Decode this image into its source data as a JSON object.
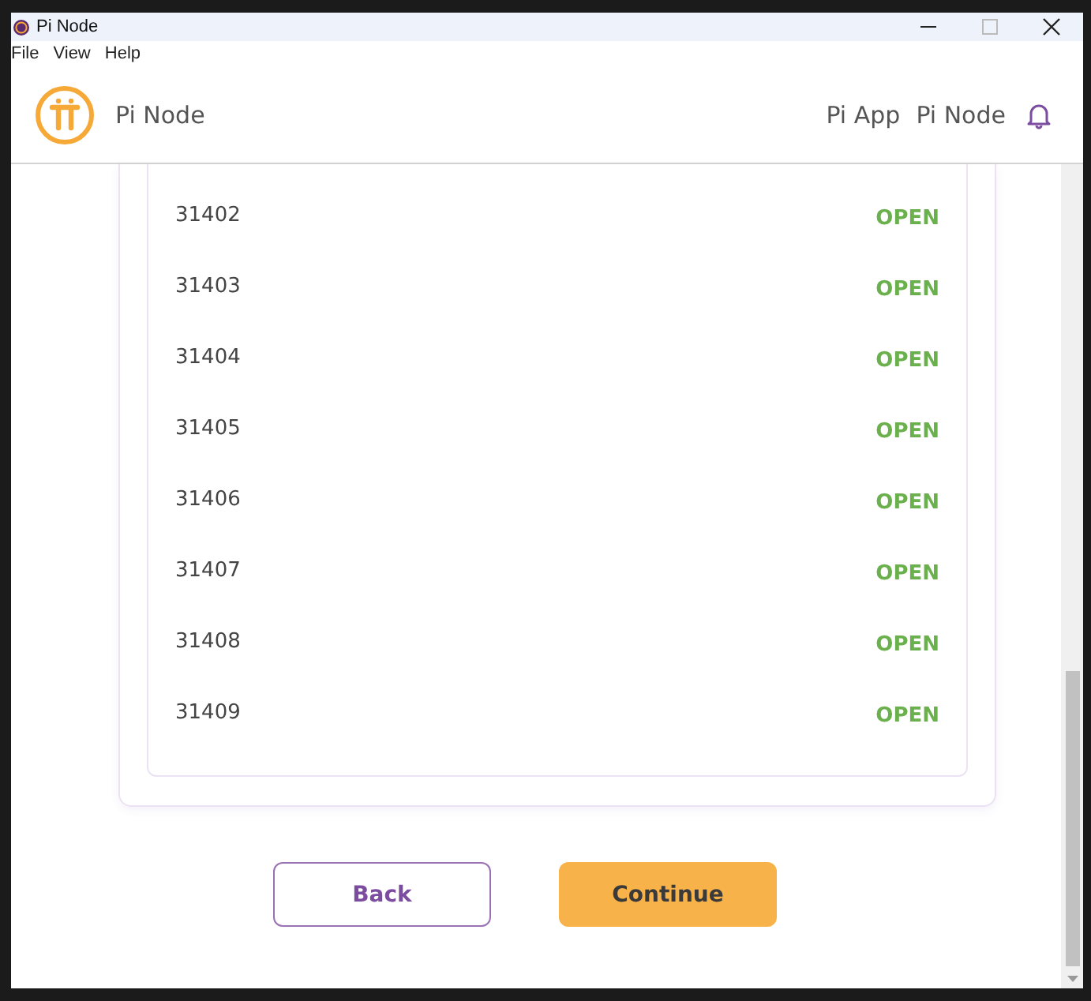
{
  "window": {
    "title": "Pi Node"
  },
  "menu": [
    "File",
    "View",
    "Help"
  ],
  "header": {
    "brand": "Pi Node",
    "nav": [
      "Pi App",
      "Pi Node"
    ]
  },
  "ports": [
    {
      "port": "31402",
      "status": "OPEN"
    },
    {
      "port": "31403",
      "status": "OPEN"
    },
    {
      "port": "31404",
      "status": "OPEN"
    },
    {
      "port": "31405",
      "status": "OPEN"
    },
    {
      "port": "31406",
      "status": "OPEN"
    },
    {
      "port": "31407",
      "status": "OPEN"
    },
    {
      "port": "31408",
      "status": "OPEN"
    },
    {
      "port": "31409",
      "status": "OPEN"
    }
  ],
  "buttons": [
    {
      "label": "Back",
      "kind": "secondary"
    },
    {
      "label": "Continue",
      "kind": "primary"
    }
  ]
}
